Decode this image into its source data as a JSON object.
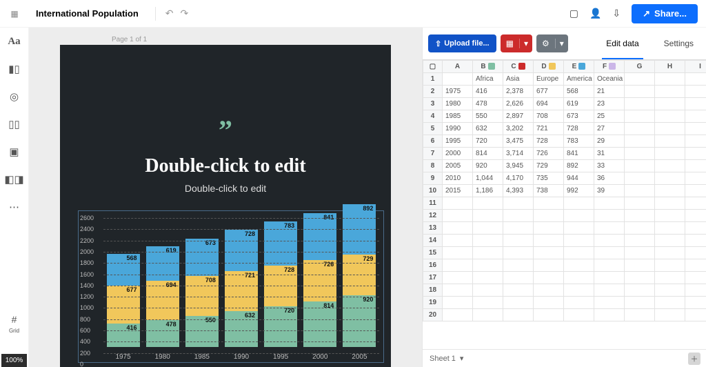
{
  "header": {
    "doc_title": "International Population",
    "share_label": "Share..."
  },
  "rail": {
    "grid_label": "Grid",
    "zoom": "100%"
  },
  "canvas": {
    "page_indicator": "Page 1 of 1",
    "title": "Double-click to edit",
    "subtitle": "Double-click to edit"
  },
  "chart_data": {
    "type": "bar",
    "stacked": true,
    "categories": [
      "1975",
      "1980",
      "1985",
      "1990",
      "1995",
      "2000",
      "2005"
    ],
    "series": [
      {
        "name": "Africa",
        "color": "#7fbfa3",
        "values": [
          416,
          478,
          550,
          632,
          720,
          814,
          920
        ]
      },
      {
        "name": "Europe",
        "color": "#f1c75b",
        "values": [
          677,
          694,
          708,
          721,
          728,
          726,
          729
        ]
      },
      {
        "name": "America",
        "color": "#4aa7da",
        "values": [
          568,
          619,
          673,
          728,
          783,
          841,
          892
        ]
      }
    ],
    "ylim": [
      0,
      2600
    ],
    "ytick_step": 200,
    "xlabel": "",
    "ylabel": ""
  },
  "datapanel": {
    "upload_label": "Upload file...",
    "tabs": {
      "edit": "Edit data",
      "settings": "Settings"
    },
    "columns": [
      "A",
      "B",
      "C",
      "D",
      "E",
      "F",
      "G",
      "H",
      "I"
    ],
    "series_headers": {
      "B": "Africa",
      "C": "Asia",
      "D": "Europe",
      "E": "America",
      "F": "Oceania"
    },
    "rows": [
      [
        "",
        "Africa",
        "Asia",
        "Europe",
        "America",
        "Oceania"
      ],
      [
        "1975",
        "416",
        "2,378",
        "677",
        "568",
        "21"
      ],
      [
        "1980",
        "478",
        "2,626",
        "694",
        "619",
        "23"
      ],
      [
        "1985",
        "550",
        "2,897",
        "708",
        "673",
        "25"
      ],
      [
        "1990",
        "632",
        "3,202",
        "721",
        "728",
        "27"
      ],
      [
        "1995",
        "720",
        "3,475",
        "728",
        "783",
        "29"
      ],
      [
        "2000",
        "814",
        "3,714",
        "726",
        "841",
        "31"
      ],
      [
        "2005",
        "920",
        "3,945",
        "729",
        "892",
        "33"
      ],
      [
        "2010",
        "1,044",
        "4,170",
        "735",
        "944",
        "36"
      ],
      [
        "2015",
        "1,186",
        "4,393",
        "738",
        "992",
        "39"
      ]
    ],
    "empty_row_count": 10,
    "sheet_name": "Sheet 1"
  }
}
